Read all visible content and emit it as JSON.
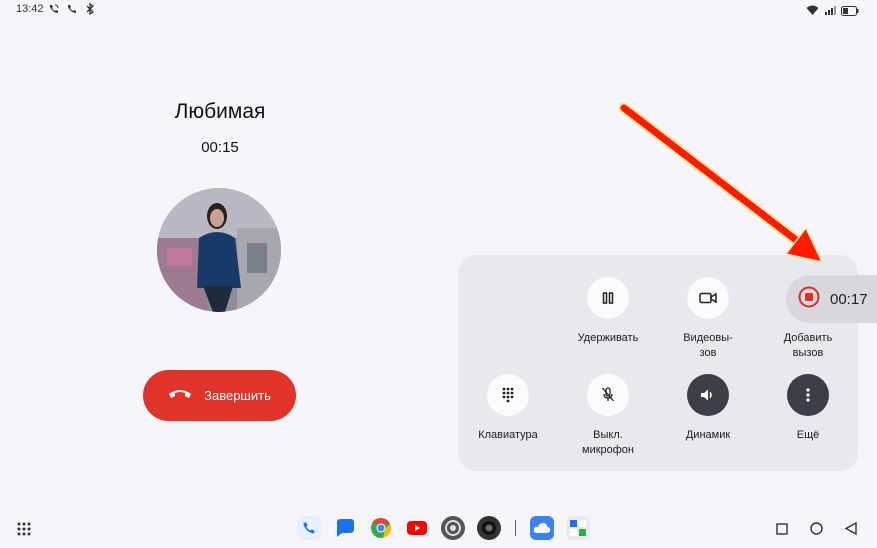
{
  "status_bar": {
    "time": "13:42"
  },
  "call": {
    "caller_name": "Любимая",
    "duration": "00:15",
    "end_call_label": "Завершить"
  },
  "controls": {
    "hold_label": "Удерживать",
    "video_label_line1": "Видеовы-",
    "video_label_line2": "зов",
    "add_call_label_line1": "Добавить",
    "add_call_label_line2": "вызов",
    "keypad_label": "Клавиатура",
    "mute_label_line1": "Выкл.",
    "mute_label_line2": "микрофон",
    "speaker_label": "Динамик",
    "more_label": "Ещё"
  },
  "recording": {
    "elapsed": "00:17",
    "color": "#d93025"
  },
  "colors": {
    "end_call": "#e0342a",
    "arrow": "#ff1a00"
  },
  "icons": {
    "status": [
      "wifi-calling-icon",
      "phone-icon",
      "bluetooth-icon",
      "wifi-icon",
      "signal-icon",
      "battery-icon"
    ],
    "dock": [
      "phone-app-icon",
      "messages-app-icon",
      "chrome-app-icon",
      "youtube-app-icon",
      "settings-app-icon",
      "camera-app-icon",
      "cloud-app-icon",
      "calculator-app-icon"
    ]
  }
}
